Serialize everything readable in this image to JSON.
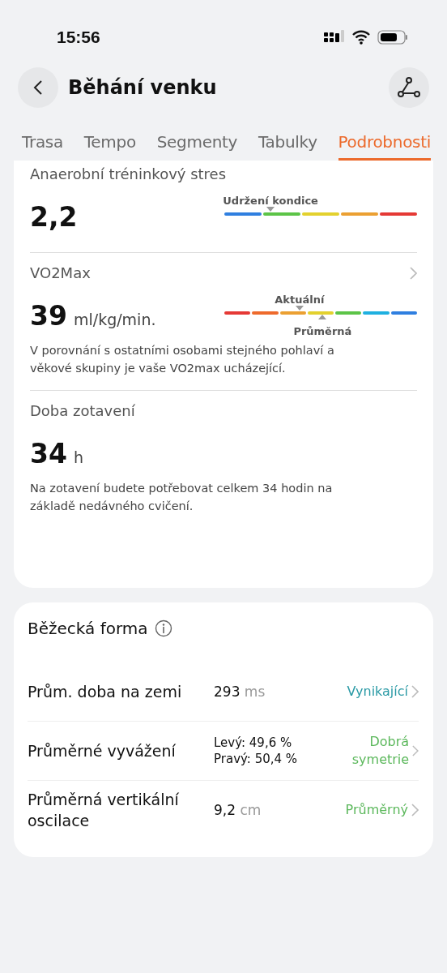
{
  "status_bar": {
    "time": "15:56"
  },
  "header": {
    "title": "Běhání venku"
  },
  "tabs": [
    {
      "label": "Trasa",
      "selected": false
    },
    {
      "label": "Tempo",
      "selected": false
    },
    {
      "label": "Segmenty",
      "selected": false
    },
    {
      "label": "Tabulky",
      "selected": false
    },
    {
      "label": "Podrobnosti",
      "selected": true
    }
  ],
  "metrics": [
    {
      "title": "Anaerobní tréninkový stres",
      "value": "2,2",
      "has_chevron": false,
      "scale": {
        "segments": [
          {
            "color": "#2f7fe0"
          },
          {
            "color": "#5cc447"
          },
          {
            "color": "#e3d12e"
          },
          {
            "color": "#eba032"
          },
          {
            "color": "#e53935"
          }
        ],
        "markers": [
          {
            "label": "Udržení kondice",
            "kind": "above",
            "level": 0.24
          }
        ]
      }
    },
    {
      "title": "VO2Max",
      "value": "39",
      "unit": "ml/kg/min.",
      "has_chevron": true,
      "scale": {
        "segments": [
          {
            "color": "#e53935"
          },
          {
            "color": "#ee6a2c"
          },
          {
            "color": "#eba032"
          },
          {
            "color": "#e3d12e"
          },
          {
            "color": "#5cc447"
          },
          {
            "color": "#1fb0e0"
          },
          {
            "color": "#2f7fe0"
          }
        ],
        "markers": [
          {
            "label": "Aktuální",
            "kind": "above",
            "level": 0.39
          },
          {
            "label": "Průměrná",
            "kind": "below"
          }
        ]
      },
      "description": "V porovnání s ostatními osobami stejného pohlaví a věkové skupiny je vaše VO2max ucházející."
    },
    {
      "title": "Doba zotavení",
      "value": "34",
      "unit": "h",
      "has_chevron": false,
      "description": "Na zotavení budete potřebovat celkem 34 hodin na základě nedávného cvičení."
    }
  ],
  "running_form": {
    "title": "Běžecká forma",
    "rows": [
      {
        "label": "Prům. doba na zemi",
        "value": "293",
        "unit": "ms",
        "rating": "Vynikající",
        "color": "#2a9aa5"
      },
      {
        "label": "Průměrné vyvážení",
        "value_lines": [
          "Levý: 49,6 %",
          "Pravý: 50,4 %"
        ],
        "rating": "Dobrá symetrie",
        "color": "#5cb85c"
      },
      {
        "label": "Průměrná vertikální oscilace",
        "value": "9,2",
        "unit": "cm",
        "rating": "Průměrný",
        "color": "#5cb85c"
      }
    ]
  }
}
